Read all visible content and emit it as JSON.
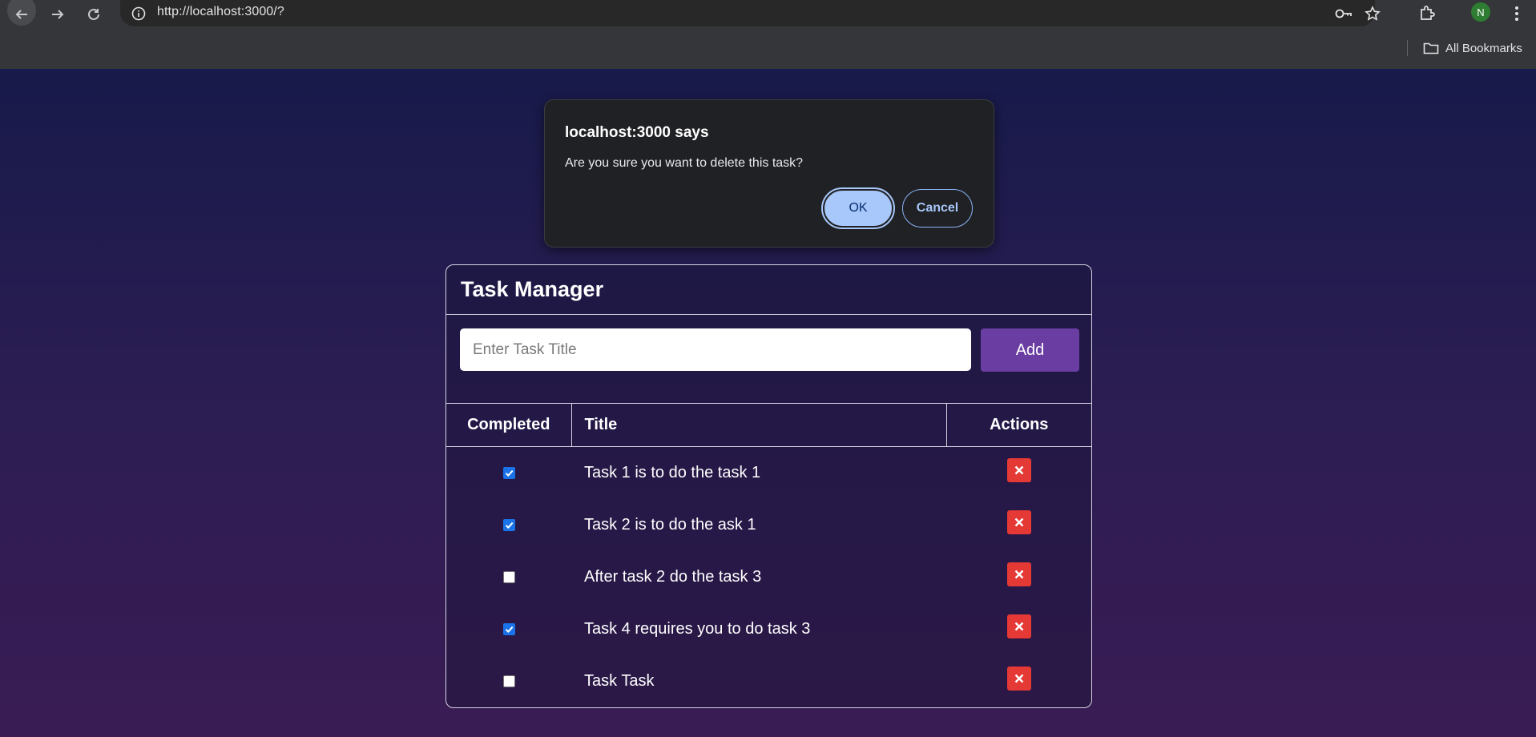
{
  "browser": {
    "url": "http://localhost:3000/?",
    "profile_initial": "N",
    "bookmarks_label": "All Bookmarks"
  },
  "dialog": {
    "title": "localhost:3000 says",
    "message": "Are you sure you want to delete this task?",
    "ok_label": "OK",
    "cancel_label": "Cancel"
  },
  "app": {
    "title": "Task Manager",
    "input_placeholder": "Enter Task Title",
    "add_label": "Add",
    "columns": {
      "completed": "Completed",
      "title": "Title",
      "actions": "Actions"
    },
    "tasks": [
      {
        "title": "Task 1 is to do the task 1",
        "completed": true
      },
      {
        "title": "Task 2 is to do the ask 1",
        "completed": true
      },
      {
        "title": "After task 2 do the task 3",
        "completed": false
      },
      {
        "title": "Task 4 requires you to do task 3",
        "completed": true
      },
      {
        "title": "Task Task",
        "completed": false
      }
    ]
  },
  "colors": {
    "accent_button": "#6a3da3",
    "delete_button": "#e53935",
    "checkbox_checked": "#1a73e8",
    "dialog_ok": "#a8c7fa"
  }
}
